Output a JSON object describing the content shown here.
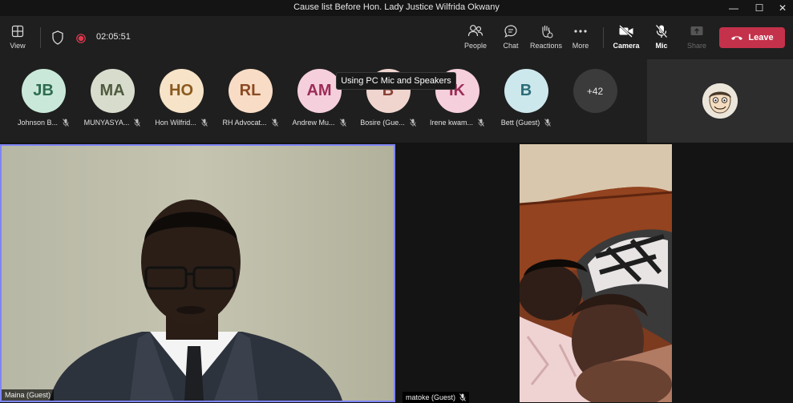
{
  "window": {
    "title": "Cause list Before Hon. Lady Justice Wilfrida Okwany",
    "controls": {
      "minimize": "—",
      "maximize": "☐",
      "close": "✕"
    }
  },
  "toolbar": {
    "view_label": "View",
    "timer": "02:05:51",
    "people_label": "People",
    "chat_label": "Chat",
    "reactions_label": "Reactions",
    "more_label": "More",
    "camera_label": "Camera",
    "mic_label": "Mic",
    "share_label": "Share",
    "leave_label": "Leave"
  },
  "tooltip": "Using PC Mic and Speakers",
  "participants": [
    {
      "initials": "JB",
      "name": "Johnson B...",
      "bg": "#c9e8d9",
      "fg": "#2d6b4f"
    },
    {
      "initials": "MA",
      "name": "MUNYASYA...",
      "bg": "#d8dccd",
      "fg": "#4f5a3e"
    },
    {
      "initials": "HO",
      "name": "Hon Wilfrid...",
      "bg": "#f6e3c8",
      "fg": "#8a5a1e"
    },
    {
      "initials": "RL",
      "name": "RH Advocat...",
      "bg": "#f8dcc6",
      "fg": "#8b4a22"
    },
    {
      "initials": "AM",
      "name": "Andrew Mu...",
      "bg": "#f5cfdc",
      "fg": "#9b2d57"
    },
    {
      "initials": "B",
      "name": "Bosire (Gue...",
      "bg": "#f0d5cf",
      "fg": "#8a4236"
    },
    {
      "initials": "IK",
      "name": "Irene kwam...",
      "bg": "#f6cfdc",
      "fg": "#9b2d57"
    },
    {
      "initials": "B",
      "name": "Bett (Guest)",
      "bg": "#cde8ec",
      "fg": "#2b6d7a"
    }
  ],
  "overflow_count": "+42",
  "videos": {
    "main_name": "Maina (Guest)",
    "second_name": "matoke (Guest)"
  },
  "colors": {
    "accent": "#7f85f5",
    "leave": "#c4314b",
    "recording": "#e03a4f"
  }
}
